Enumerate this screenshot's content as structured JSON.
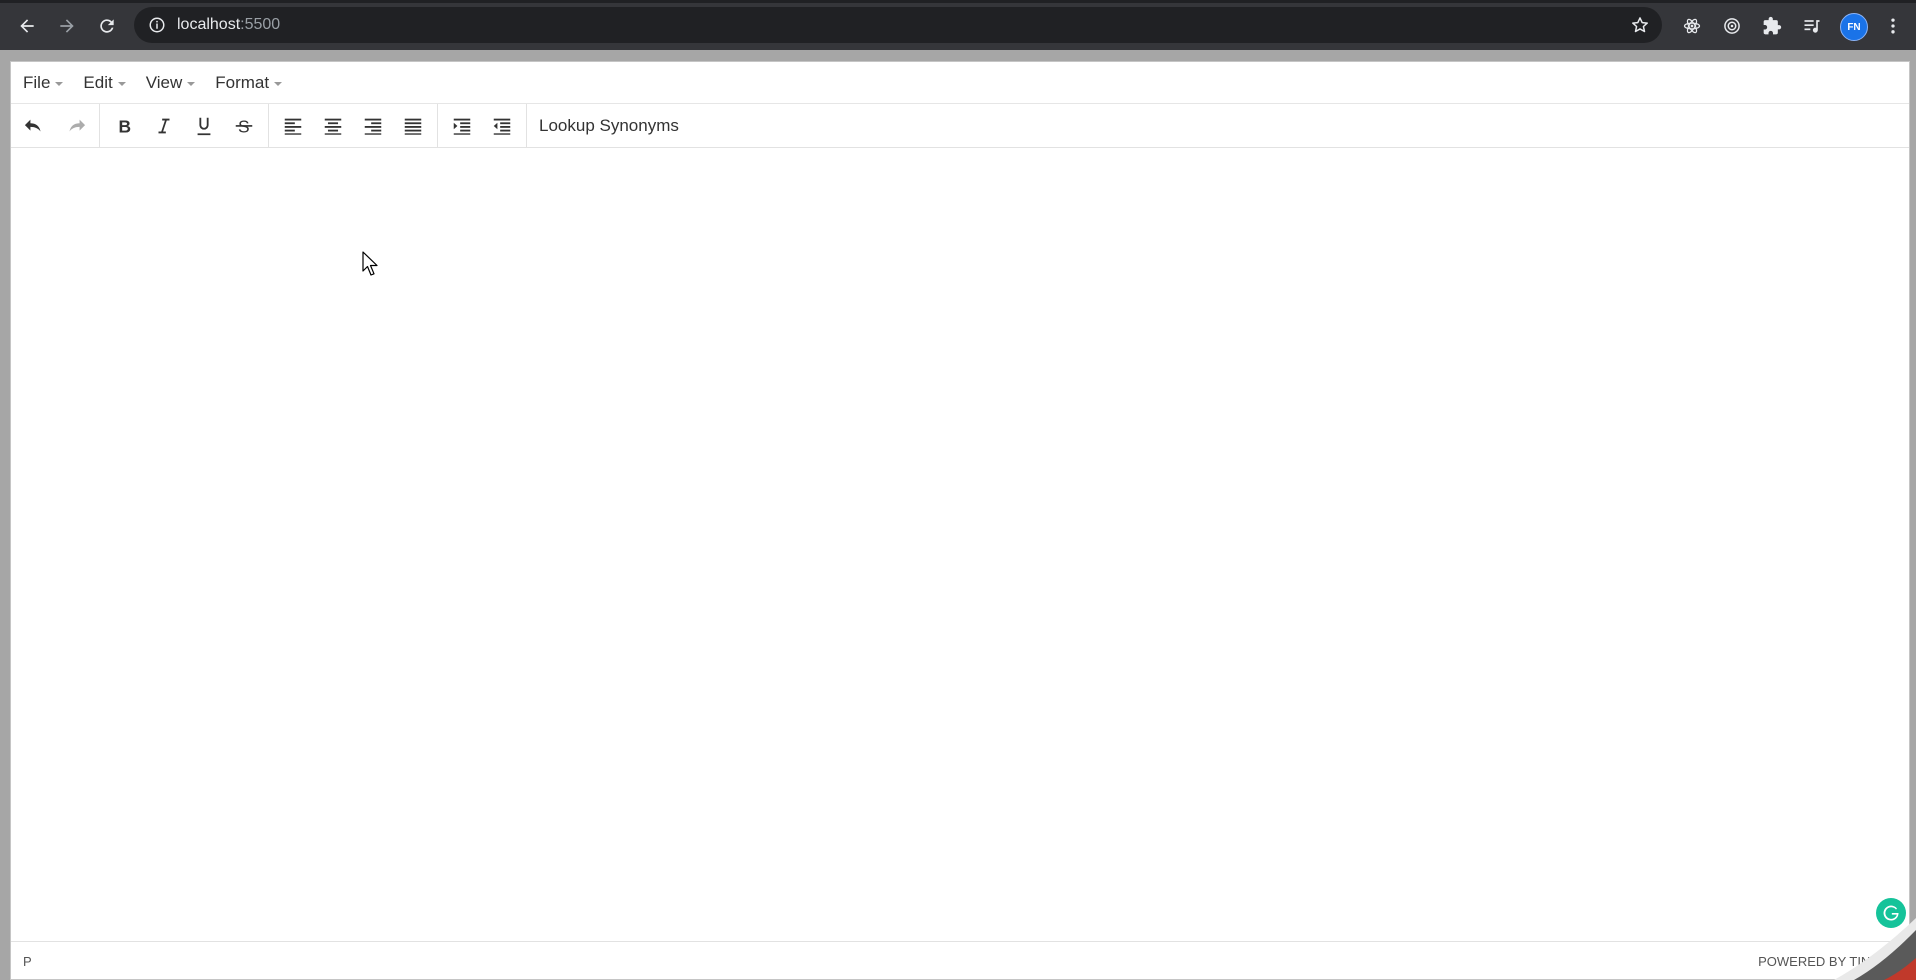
{
  "browser": {
    "url_host": "localhost",
    "url_port": ":5500",
    "profile_initials": "FN"
  },
  "editor": {
    "menus": [
      {
        "label": "File"
      },
      {
        "label": "Edit"
      },
      {
        "label": "View"
      },
      {
        "label": "Format"
      }
    ],
    "toolbar": {
      "lookup_label": "Lookup Synonyms"
    },
    "status": {
      "path": "P",
      "branding": "POWERED BY TINY"
    }
  },
  "colors": {
    "chrome_bg": "#35363a",
    "omnibox_bg": "#202124",
    "profile_blue": "#1a73e8",
    "grammarly_green": "#15c39a"
  }
}
